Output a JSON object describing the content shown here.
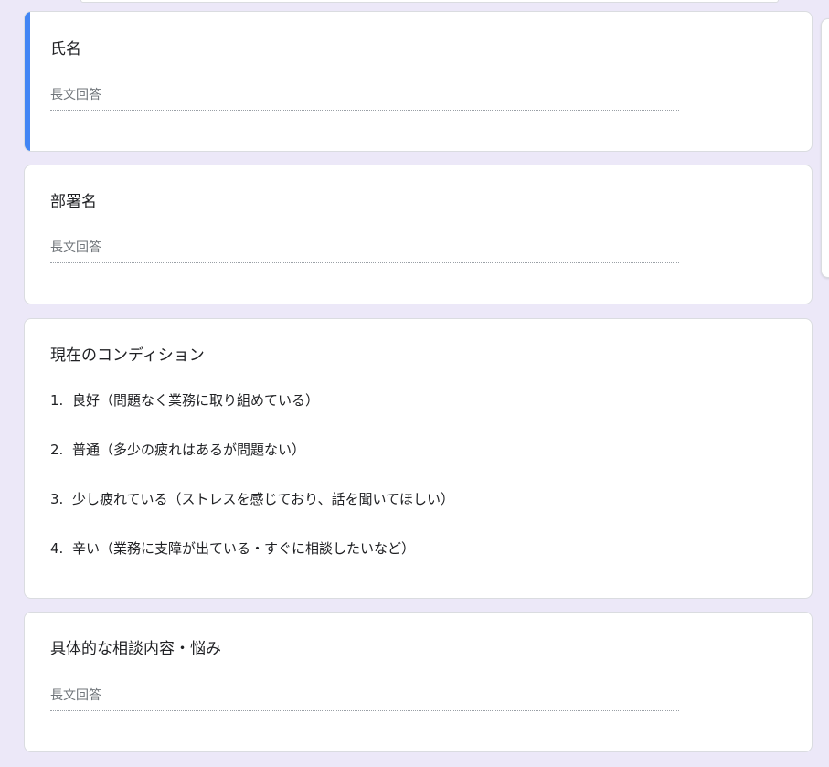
{
  "form": {
    "questions": [
      {
        "title": "氏名",
        "placeholder": "長文回答"
      },
      {
        "title": "部署名",
        "placeholder": "長文回答"
      },
      {
        "title": "現在のコンディション",
        "options": [
          {
            "num": "1.",
            "label": "良好（問題なく業務に取り組めている）"
          },
          {
            "num": "2.",
            "label": "普通（多少の疲れはあるが問題ない）"
          },
          {
            "num": "3.",
            "label": "少し疲れている（ストレスを感じており、話を聞いてほしい）"
          },
          {
            "num": "4.",
            "label": "辛い（業務に支障が出ている・すぐに相談したいなど）"
          }
        ]
      },
      {
        "title": "具体的な相談内容・悩み",
        "placeholder": "長文回答"
      }
    ]
  },
  "colors": {
    "background": "#ece8f8",
    "active_accent": "#4285f4",
    "card": "#ffffff"
  }
}
